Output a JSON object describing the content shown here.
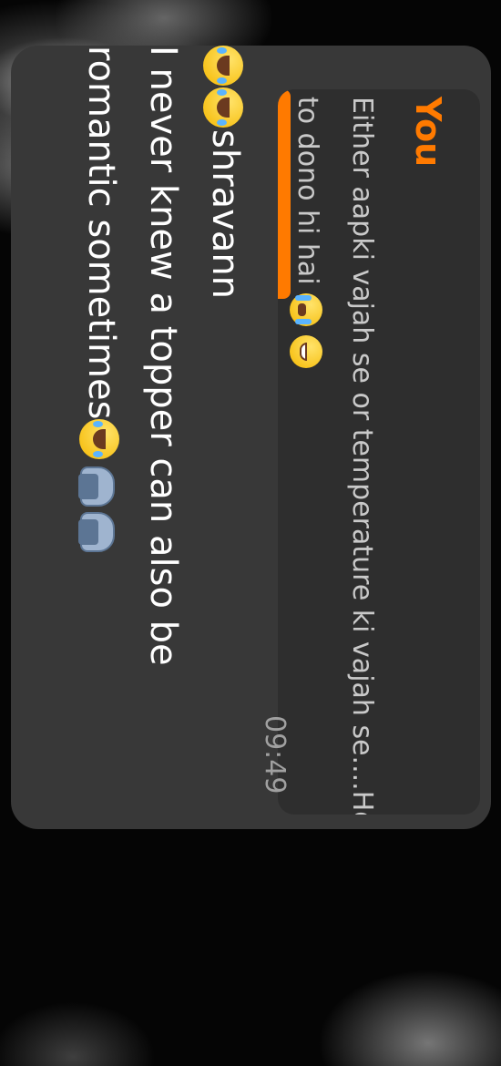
{
  "message": {
    "quoted": {
      "author": "You",
      "text": "Either aapki vajah se or temperature ki vajah se....Hot to dono hi hai"
    },
    "reply": {
      "line1_text": "shravann",
      "line2_text": "I never knew a topper can also be romantic sometimes"
    },
    "time": "09:49"
  },
  "colors": {
    "accent": "#ff7a00",
    "bubble_bg": "#383838",
    "quote_bg": "#2e2e2e",
    "text_primary": "#ffffff",
    "text_secondary": "#a0a0a0"
  },
  "icons": {
    "quote_emojis": [
      "grinning-face-icon",
      "loudly-crying-face-icon"
    ],
    "reply_emojis_start": [
      "face-with-tears-of-joy-icon",
      "face-with-tears-of-joy-icon"
    ],
    "reply_emojis_end": [
      "face-with-tears-of-joy-icon",
      "folded-hands-icon",
      "folded-hands-icon"
    ]
  }
}
